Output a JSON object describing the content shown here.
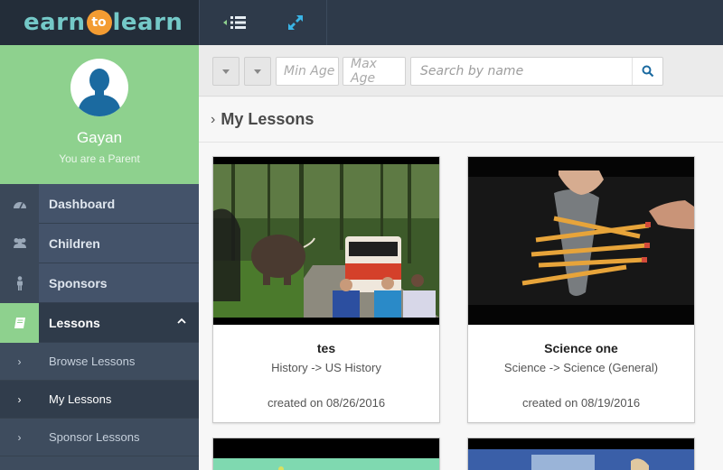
{
  "brand": {
    "part1": "earn",
    "part2": "to",
    "part3": "learn"
  },
  "topbar": {
    "menu_icon": "menu-collapse-icon",
    "expand_icon": "expand-icon"
  },
  "profile": {
    "name": "Gayan",
    "role": "You are a Parent"
  },
  "sidebar": {
    "items": [
      {
        "label": "Dashboard",
        "icon": "dashboard-icon"
      },
      {
        "label": "Children",
        "icon": "users-icon"
      },
      {
        "label": "Sponsors",
        "icon": "person-icon"
      },
      {
        "label": "Lessons",
        "icon": "book-icon"
      }
    ],
    "sub_items": [
      {
        "label": "Browse Lessons"
      },
      {
        "label": "My Lessons"
      },
      {
        "label": "Sponsor Lessons"
      }
    ]
  },
  "filters": {
    "min_age_placeholder": "Min Age",
    "max_age_placeholder": "Max Age",
    "search_placeholder": "Search by name"
  },
  "page": {
    "title": "My Lessons"
  },
  "lessons": [
    {
      "title": "tes",
      "category": "History -> US History",
      "created": "created on 08/26/2016"
    },
    {
      "title": "Science one",
      "category": "Science -> Science (General)",
      "created": "created on 08/19/2016"
    }
  ],
  "colors": {
    "accent_green": "#8ed18e",
    "sidebar_bg": "#3a4757",
    "topbar_bg": "#2e3a4a",
    "brand_teal": "#74c9c8",
    "brand_orange": "#f39c32"
  }
}
